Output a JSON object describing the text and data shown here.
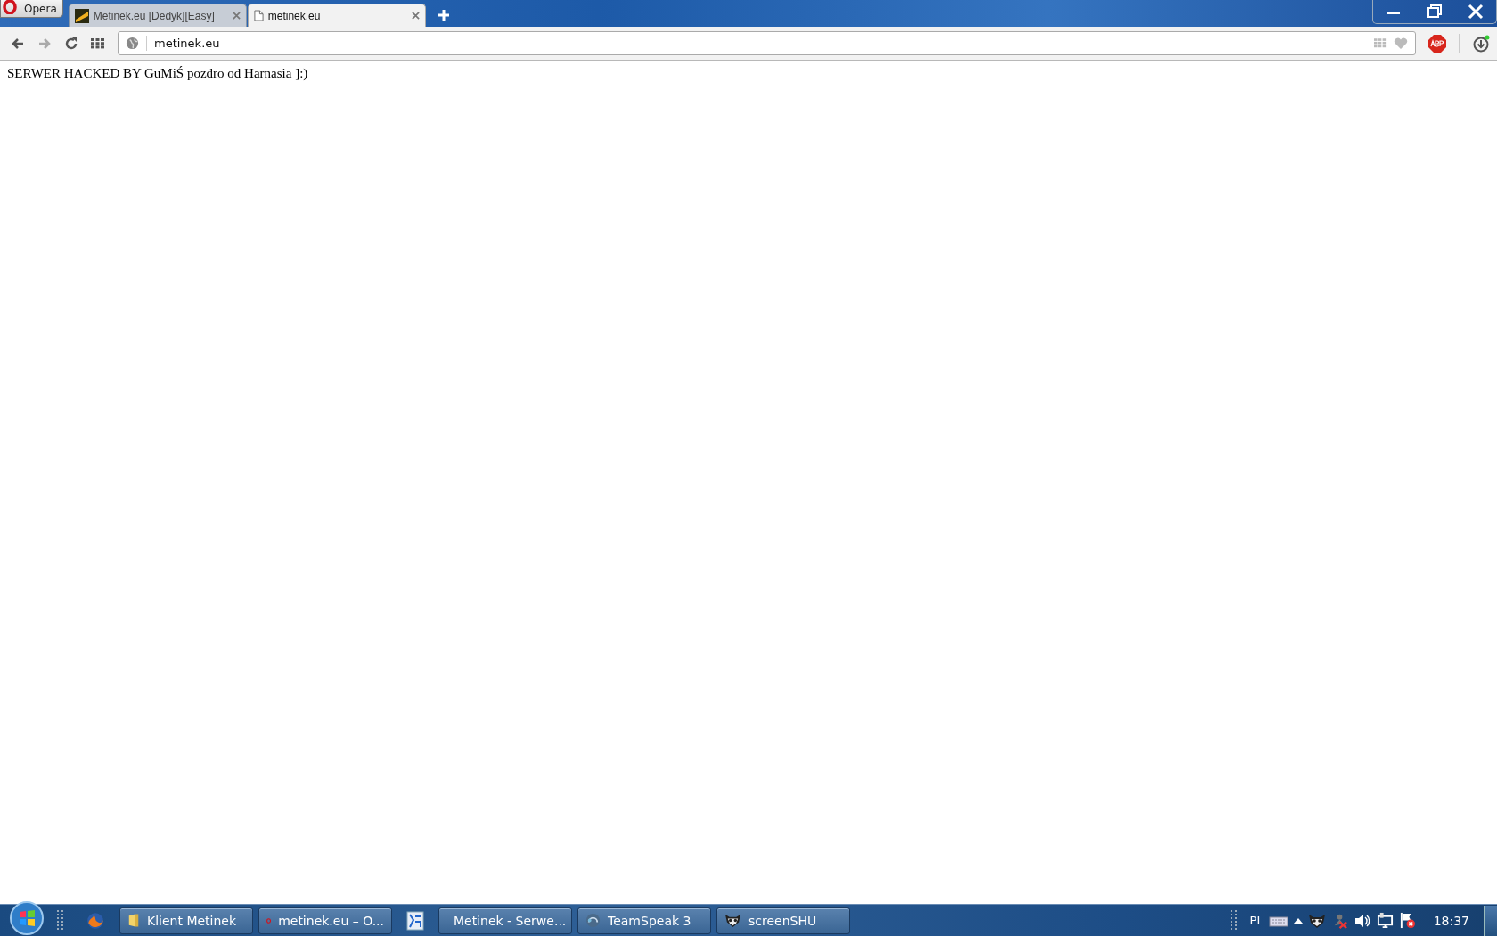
{
  "browser": {
    "menu_label": "Opera",
    "tabs": [
      {
        "label": "Metinek.eu [Dedyk][Easy]",
        "selected": false
      },
      {
        "label": "metinek.eu",
        "selected": true
      }
    ],
    "address": "metinek.eu"
  },
  "page": {
    "text": "SERWER HACKED BY GuMiŚ pozdro od Harnasia ]:)"
  },
  "taskbar": {
    "buttons": [
      {
        "label": "Klient Metinek",
        "kind": "folder"
      },
      {
        "label": "metinek.eu – O...",
        "kind": "opera"
      },
      {
        "label": "Metinek - Serwe...",
        "kind": "game"
      },
      {
        "label": "TeamSpeak 3",
        "kind": "teamspeak"
      },
      {
        "label": "screenSHU",
        "kind": "lemur"
      }
    ],
    "language": "PL",
    "clock": "18:37"
  }
}
